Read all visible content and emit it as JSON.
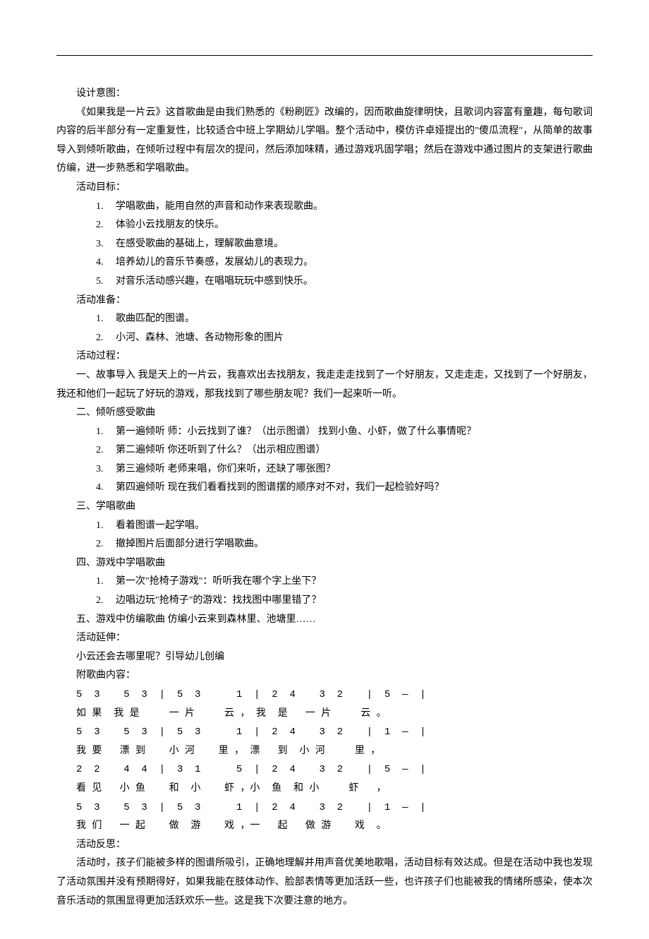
{
  "sections": {
    "design_label": "设计意图：",
    "design_text": "《如果我是一片云》这首歌曲是由我们熟悉的《粉刷匠》改编的，因而歌曲旋律明快，且歌词内容富有童趣，每句歌词内容的后半部分有一定重复性，比较适合中班上学期幼儿学唱。整个活动中，模仿许卓娅提出的\"傻瓜流程\"，从简单的故事导入到倾听歌曲，在倾听过程中有层次的提问，然后添加味精，通过游戏巩固学唱；然后在游戏中通过图片的支架进行歌曲仿编，进一步熟悉和学唱歌曲。",
    "goal_label": "活动目标：",
    "goals": [
      "学唱歌曲，能用自然的声音和动作来表现歌曲。",
      "体验小云找朋友的快乐。",
      "在感受歌曲的基础上，理解歌曲意境。",
      "培养幼儿的音乐节奏感，发展幼儿的表现力。",
      "对音乐活动感兴趣，在唱唱玩玩中感到快乐。"
    ],
    "prep_label": "活动准备：",
    "preps": [
      "歌曲匹配的图谱。",
      "小河、森林、池塘、各动物形象的图片"
    ],
    "process_label": "活动过程：",
    "story_intro": "一、故事导入  我是天上的一片云，我喜欢出去找朋友，我走走走找到了一个好朋友，又走走走，又找到了一个好朋友，我还和他们一起玩了好玩的游戏，那我找到了哪些朋友呢？我们一起来听一听。",
    "listen_label": "二、倾听感受歌曲",
    "listen_items": [
      "第一遍倾听  师：小云找到了谁？（出示图谱）  找到小鱼、小虾，做了什么事情呢？",
      "第二遍倾听  你还听到了什么？（出示相应图谱）",
      "第三遍倾听  老师来唱，你们来听，还缺了哪张图？",
      "第四遍倾听  现在我们看看找到的图谱摆的顺序对不对，我们一起检验好吗？"
    ],
    "learn_label": "三、学唱歌曲",
    "learn_items": [
      "看着图谱一起学唱。",
      "撤掉图片后面部分进行学唱歌曲。"
    ],
    "game_label": "四、游戏中学唱歌曲",
    "game_items": [
      "第一次\"抢椅子游戏\"：听听我在哪个字上坐下？",
      "边唱边玩\"抢椅子\"的游戏：找找图中哪里错了？"
    ],
    "adapt_label": "五、游戏中仿编歌曲  仿编小云来到森林里、池塘里……",
    "extension_label": "活动延伸：",
    "extension_text": "小云还会去哪里呢？引导幼儿创编",
    "lyrics_label": "附歌曲内容：",
    "score_lines": [
      "5  3    5  3  |  5  3      1  |  2  4    3  2    |  5  —  |",
      "如 果  我 是     一 片     云 ， 我  是   一 片     云 。",
      "5  3    5  3  |  5  3      1  |  2  4    3  2    |  1  —  |",
      "我 要   漂 到    小 河    里 ， 漂   到  小 河     里 ，",
      "2  2    4  4  |  3  1      5  |  2  4    3  2    |  5  —  |",
      "看 见   小 鱼    和  小    虾 ，小  鱼  和 小     虾   ，",
      "5  3    5  3  |  5  3      1  |  2  4    3  2    |  1  —  |",
      "我 们   一 起    做  游    戏 ，一   起   做 游    戏  。"
    ],
    "reflect_label": "活动反思：",
    "reflect_text": "活动时，孩子们能被多样的图谱所吸引，正确地理解并用声音优美地歌唱，活动目标有效达成。但是在活动中我也发现了活动氛围并没有预期得好，如果我能在肢体动作、脸部表情等更加活跃一些，也许孩子们也能被我的情绪所感染，使本次音乐活动的氛围显得更加活跃欢乐一些。这是我下次要注意的地方。"
  }
}
